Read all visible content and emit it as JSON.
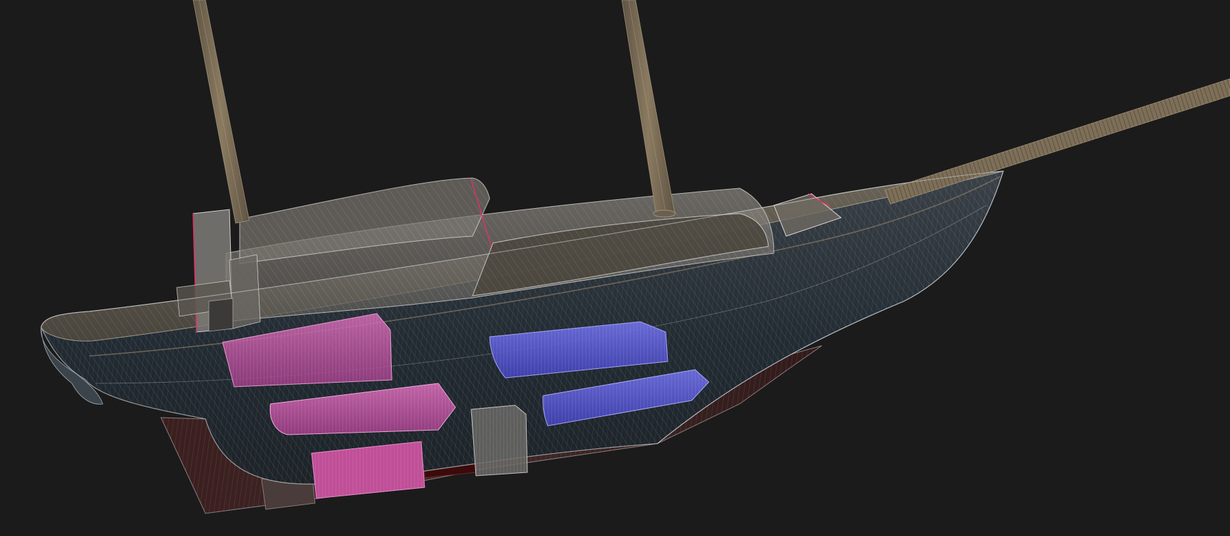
{
  "viewport": {
    "background": "#1b1b1b",
    "render_mode": "wireframe-transparent",
    "model": "sailboat-hull-3d"
  },
  "colors": {
    "hull_fill": "#2a333c",
    "hull_edge": "#b0b4b8",
    "deck_fill": "#5d574c",
    "cabin_fill": "#8a8680",
    "keel_fill": "#3a2020",
    "keel_dark": "#3d0d0d",
    "mast_fill": "#7a6c56",
    "tank_magenta": "#c0559e",
    "tank_magenta_edge": "#e48fce",
    "tank_blue": "#5555d0",
    "tank_blue_edge": "#9a9cf2",
    "engine_gray": "#6a6866",
    "accent_red_edge": "#e03068"
  },
  "components": {
    "masts": [
      "aft-mast",
      "main-mast"
    ],
    "spar": "bowsprit",
    "tanks_magenta": [
      "magenta-tank-upper",
      "magenta-tank-lower",
      "magenta-tank-keel"
    ],
    "tanks_blue": [
      "blue-tank-upper",
      "blue-tank-lower"
    ],
    "other": [
      "engine-block",
      "aft-cabin-box",
      "main-cabin-trunk",
      "forward-cockpit",
      "forward-hatch",
      "keel"
    ]
  }
}
